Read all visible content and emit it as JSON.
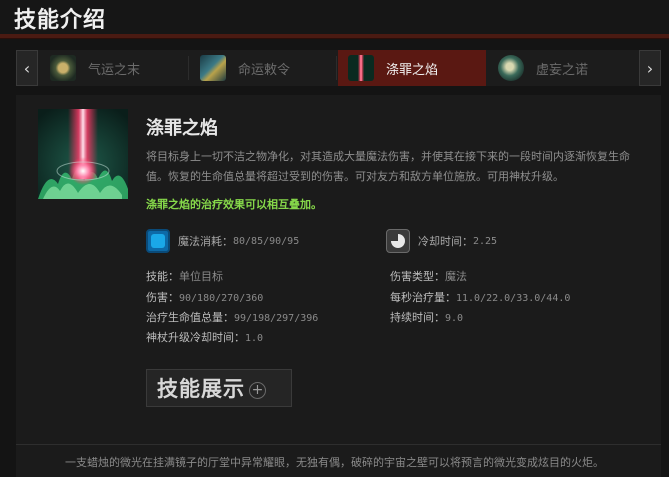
{
  "header": {
    "title": "技能介绍"
  },
  "tabs": [
    {
      "label": "气运之末",
      "icon": "fate-end-icon",
      "active": false
    },
    {
      "label": "命运敕令",
      "icon": "fate-edict-icon",
      "active": false
    },
    {
      "label": "涤罪之焰",
      "icon": "purifying-flames-icon",
      "active": true
    },
    {
      "label": "虚妄之诺",
      "icon": "false-promise-icon",
      "active": false
    }
  ],
  "nav": {
    "prev_glyph": "‹",
    "next_glyph": "›"
  },
  "skill": {
    "name": "涤罪之焰",
    "description": "将目标身上一切不洁之物净化，对其造成大量魔法伤害，并使其在接下来的一段时间内逐渐恢复生命值。恢复的生命值总量将超过受到的伤害。可对友方和敌方单位施放。可用神杖升级。",
    "note": "涤罪之焰的治疗效果可以相互叠加。",
    "mana_cost": {
      "label": "魔法消耗：",
      "value": "80/85/90/95",
      "icon": "mana-icon"
    },
    "cooldown": {
      "label": "冷却时间：",
      "value": "2.25",
      "icon": "cooldown-icon"
    },
    "attributes": {
      "ability": {
        "label": "技能：",
        "value": "单位目标"
      },
      "damage_type": {
        "label": "伤害类型：",
        "value": "魔法"
      },
      "damage": {
        "label": "伤害：",
        "value": "90/180/270/360"
      },
      "heal_per_sec": {
        "label": "每秒治疗量：",
        "value": "11.0/22.0/33.0/44.0"
      },
      "total_heal": {
        "label": "治疗生命值总量：",
        "value": "99/198/297/396"
      },
      "duration": {
        "label": "持续时间：",
        "value": "9.0"
      },
      "scepter_cd": {
        "label": "神杖升级冷却时间：",
        "value": "1.0"
      }
    },
    "demo_button": {
      "label": "技能展示",
      "plus": "+"
    }
  },
  "lore": "一支蜡烛的微光在挂满镜子的厅堂中异常耀眼，无独有偶，破碎的宇宙之壁可以将预言的微光变成炫目的火炬。",
  "colors": {
    "accent": "#5a1812",
    "note_green": "#86d84a",
    "header_bar": "#4a1a12"
  }
}
